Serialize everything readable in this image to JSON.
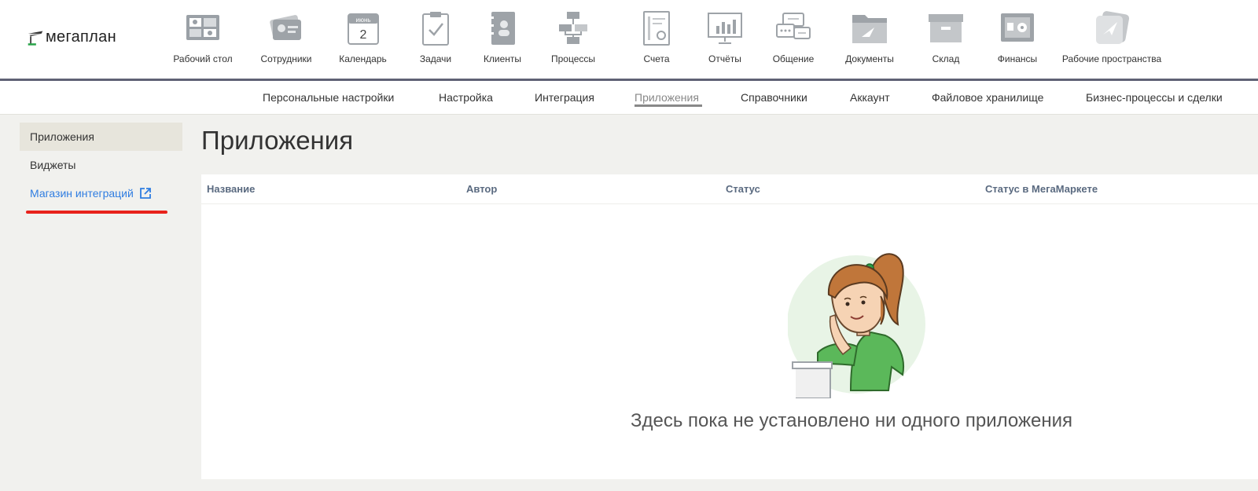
{
  "brand": {
    "name": "мегаплан"
  },
  "top_apps": [
    {
      "label": "Рабочий стол",
      "icon": "desktop-icon"
    },
    {
      "label": "Сотрудники",
      "icon": "employees-icon"
    },
    {
      "label": "Календарь",
      "icon": "calendar-icon",
      "month": "июнь",
      "day": "2"
    },
    {
      "label": "Задачи",
      "icon": "tasks-icon"
    },
    {
      "label": "Клиенты",
      "icon": "clients-icon"
    },
    {
      "label": "Процессы",
      "icon": "processes-icon"
    },
    {
      "label": "Счета",
      "icon": "invoices-icon"
    },
    {
      "label": "Отчёты",
      "icon": "reports-icon"
    },
    {
      "label": "Общение",
      "icon": "chat-icon"
    },
    {
      "label": "Документы",
      "icon": "documents-icon"
    },
    {
      "label": "Склад",
      "icon": "warehouse-icon"
    },
    {
      "label": "Финансы",
      "icon": "finance-icon"
    },
    {
      "label": "Рабочие пространства",
      "icon": "workspaces-icon"
    }
  ],
  "subnav": [
    {
      "label": "Персональные настройки"
    },
    {
      "label": "Настройка"
    },
    {
      "label": "Интеграция"
    },
    {
      "label": "Приложения",
      "active": true
    },
    {
      "label": "Справочники"
    },
    {
      "label": "Аккаунт"
    },
    {
      "label": "Файловое хранилище"
    },
    {
      "label": "Бизнес-процессы и сделки"
    }
  ],
  "sidebar": {
    "items": [
      {
        "label": "Приложения",
        "active": true
      },
      {
        "label": "Виджеты"
      },
      {
        "label": "Магазин интеграций",
        "icon": "external-link-icon"
      }
    ]
  },
  "main": {
    "title": "Приложения",
    "columns": [
      "Название",
      "Автор",
      "Статус",
      "Статус в МегаМаркете"
    ],
    "empty_message": "Здесь пока не установлено ни одного приложения"
  },
  "colors": {
    "accent_link": "#2f7de1",
    "highlight_underline": "#e8221b",
    "brand_green": "#2aa44a",
    "topbar_divider": "#5f6275"
  }
}
